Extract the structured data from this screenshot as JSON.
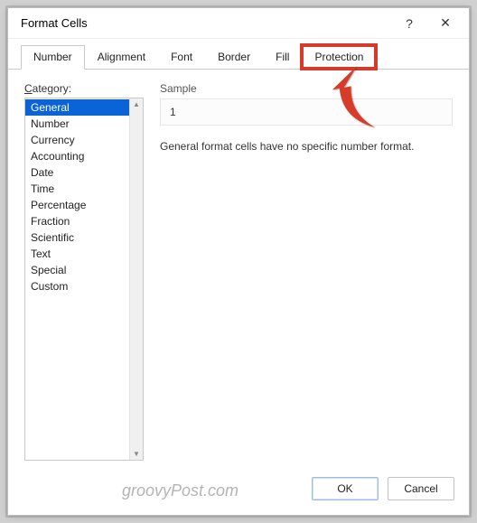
{
  "dialog": {
    "title": "Format Cells"
  },
  "tabs": {
    "number": "Number",
    "alignment": "Alignment",
    "font": "Font",
    "border": "Border",
    "fill": "Fill",
    "protection": "Protection"
  },
  "category": {
    "label_prefix": "C",
    "label_rest": "ategory:",
    "items": {
      "general": "General",
      "number": "Number",
      "currency": "Currency",
      "accounting": "Accounting",
      "date": "Date",
      "time": "Time",
      "percentage": "Percentage",
      "fraction": "Fraction",
      "scientific": "Scientific",
      "text": "Text",
      "special": "Special",
      "custom": "Custom"
    }
  },
  "sample": {
    "label": "Sample",
    "value": "1"
  },
  "description": "General format cells have no specific number format.",
  "buttons": {
    "ok": "OK",
    "cancel": "Cancel"
  },
  "watermark": "groovyPost.com",
  "icons": {
    "help": "?",
    "close": "✕",
    "up": "▲",
    "down": "▼"
  }
}
